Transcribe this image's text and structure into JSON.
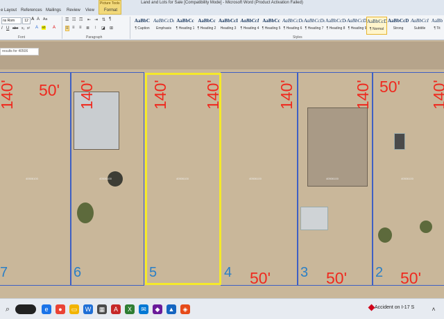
{
  "window": {
    "title": "Land and Lots for Sale [Compatibility Mode] - Microsoft Word (Product Activation Failed)"
  },
  "ribbon_tabs": [
    "e Layout",
    "References",
    "Mailings",
    "Review",
    "View"
  ],
  "picture_tools": {
    "label": "Picture Tools",
    "tab": "Format"
  },
  "font": {
    "name": "ns Rom",
    "size": "12"
  },
  "groups": {
    "font": "Font",
    "paragraph": "Paragraph",
    "styles": "Styles"
  },
  "styles": [
    {
      "sample": "AaBbC",
      "name": "¶ Caption"
    },
    {
      "sample": "AaBbCcDc",
      "name": "Emphasis"
    },
    {
      "sample": "AaBbCc",
      "name": "¶ Heading 1"
    },
    {
      "sample": "AaBbCc",
      "name": "¶ Heading 2"
    },
    {
      "sample": "AaBbCcI",
      "name": "Heading 3"
    },
    {
      "sample": "AaBbCcI",
      "name": "¶ Heading 4"
    },
    {
      "sample": "AaBbCc",
      "name": "¶ Heading 5"
    },
    {
      "sample": "AaBbCcDc",
      "name": "¶ Heading 6"
    },
    {
      "sample": "AaBbCcDc",
      "name": "¶ Heading 7"
    },
    {
      "sample": "AaBbCcDc",
      "name": "¶ Heading 8"
    },
    {
      "sample": "AaBbCcDc",
      "name": "¶ Heading 9"
    },
    {
      "sample": "AaBbCcDc",
      "name": "¶ Normal"
    },
    {
      "sample": "AaBbCcDc",
      "name": "Strong"
    },
    {
      "sample": "AaBbCcI",
      "name": "Subtitle"
    },
    {
      "sample": "AaBb",
      "name": "¶ Tit"
    }
  ],
  "search_tooltip": "results for 40506",
  "lots": [
    {
      "number": "7",
      "width": "50'",
      "depth": "140'",
      "parcel": "40506100"
    },
    {
      "number": "6",
      "width": "",
      "depth": "140'",
      "parcel": "40506100"
    },
    {
      "number": "5",
      "width": "",
      "depth": "140'",
      "parcel": "40506100"
    },
    {
      "number": "4",
      "width": "50'",
      "depth": "140'",
      "parcel": "40506100"
    },
    {
      "number": "3",
      "width": "50'",
      "depth": "140'",
      "parcel": "40506100"
    },
    {
      "number": "2",
      "width": "50'",
      "depth": "140'",
      "parcel": "40506100"
    }
  ],
  "dim_labels": {
    "d140": "140'",
    "w50": "50'"
  },
  "taskbar": {
    "notification": "Accident on I-17 S"
  },
  "colors": {
    "dimension": "#ee2a1f",
    "lot_line": "#3d5fc4",
    "selected": "#f5e92a",
    "lot_number": "#2a7fc6"
  }
}
